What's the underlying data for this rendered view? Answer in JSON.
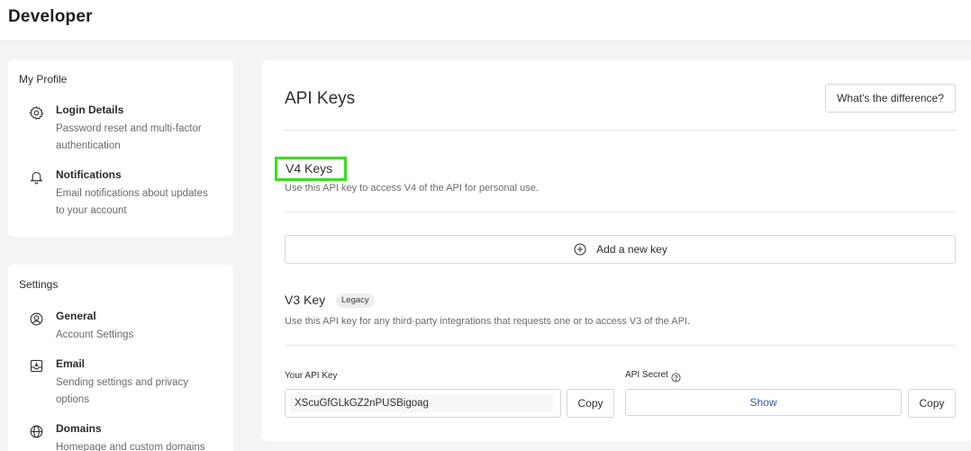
{
  "header": {
    "title": "Developer"
  },
  "profile": {
    "section_title": "My Profile",
    "items": [
      {
        "icon": "gear-icon",
        "title": "Login Details",
        "description": "Password reset and multi-factor authentication"
      },
      {
        "icon": "bell-icon",
        "title": "Notifications",
        "description": "Email notifications about updates to your account"
      }
    ]
  },
  "settings": {
    "section_title": "Settings",
    "items": [
      {
        "icon": "user-circle-icon",
        "title": "General",
        "description": "Account Settings"
      },
      {
        "icon": "inbox-icon",
        "title": "Email",
        "description": "Sending settings and privacy options"
      },
      {
        "icon": "globe-icon",
        "title": "Domains",
        "description": "Homepage and custom domains"
      }
    ]
  },
  "main": {
    "title": "API Keys",
    "difference_button": "What's the difference?",
    "v4": {
      "title": "V4 Keys",
      "description": "Use this API key to access V4 of the API for personal use.",
      "add_button": "Add a new key"
    },
    "v3": {
      "title": "V3 Key",
      "badge": "Legacy",
      "description": "Use this API key for any third-party integrations that requests one or to access V3 of the API.",
      "api_key_label": "Your API Key",
      "api_key_value": "XScuGfGLkGZ2nPUSBigoag",
      "copy_label": "Copy",
      "api_secret_label": "API Secret",
      "show_label": "Show",
      "copy_secret_label": "Copy"
    }
  },
  "colors": {
    "highlight": "#38e01a",
    "link": "#2f5da6"
  }
}
